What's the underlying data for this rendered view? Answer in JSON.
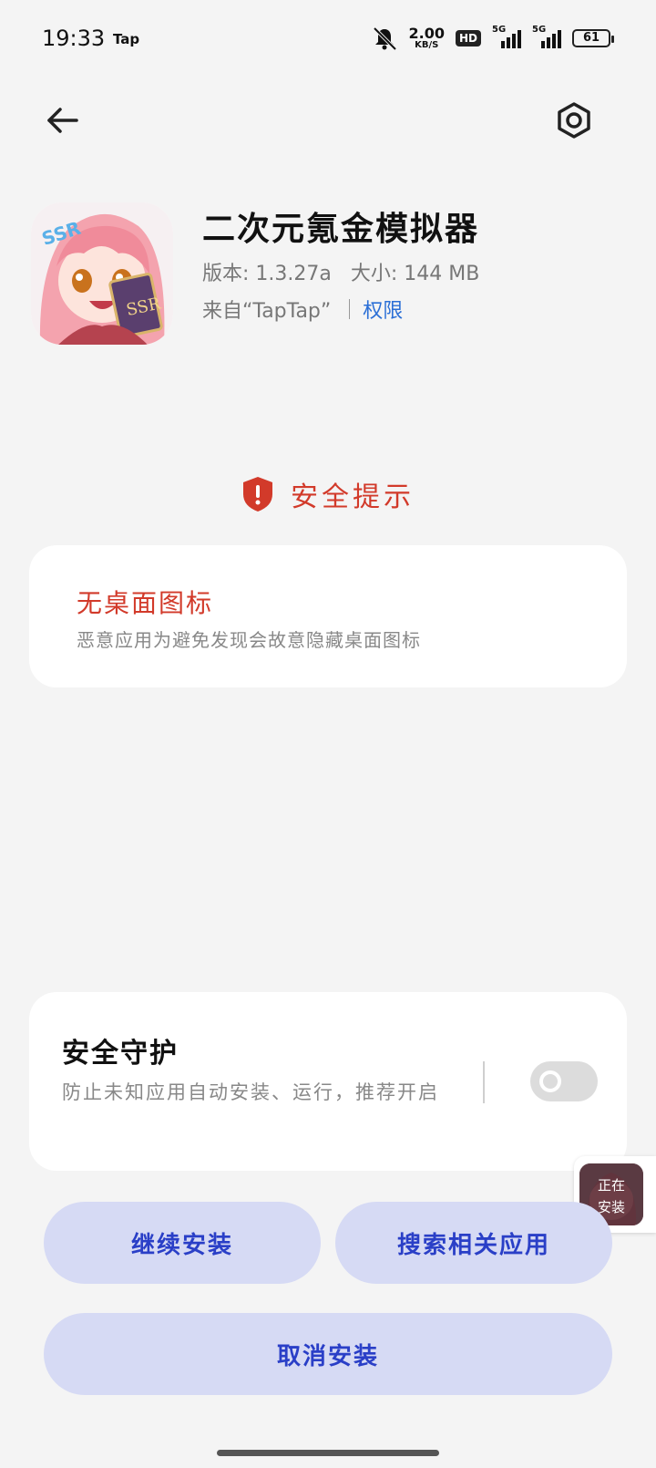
{
  "status_bar": {
    "time": "19:33",
    "notification_app": "Tap",
    "net_speed_value": "2.00",
    "net_speed_unit": "KB/S",
    "hd_label": "HD",
    "signal1_label": "5G",
    "signal2_label": "5G",
    "battery": "61"
  },
  "app": {
    "name": "二次元氪金模拟器",
    "meta": "版本: 1.3.27a   大小: 144 MB",
    "source": "来自“TapTap”",
    "permissions_link": "权限"
  },
  "safety": {
    "title": "安全提示",
    "warning_title": "无桌面图标",
    "warning_desc": "恶意应用为避免发现会故意隐藏桌面图标"
  },
  "guard": {
    "title": "安全守护",
    "desc": "防止未知应用自动安装、运行，推荐开启",
    "toggle_on": false
  },
  "floating_badge": {
    "line1": "正在",
    "line2": "安装"
  },
  "buttons": {
    "continue": "继续安装",
    "search": "搜索相关应用",
    "cancel": "取消安装"
  },
  "colors": {
    "accent_blue": "#2a3fc7",
    "button_bg": "#d6daf4",
    "warning_red": "#d23a2a",
    "link_blue": "#2b6fd6"
  }
}
